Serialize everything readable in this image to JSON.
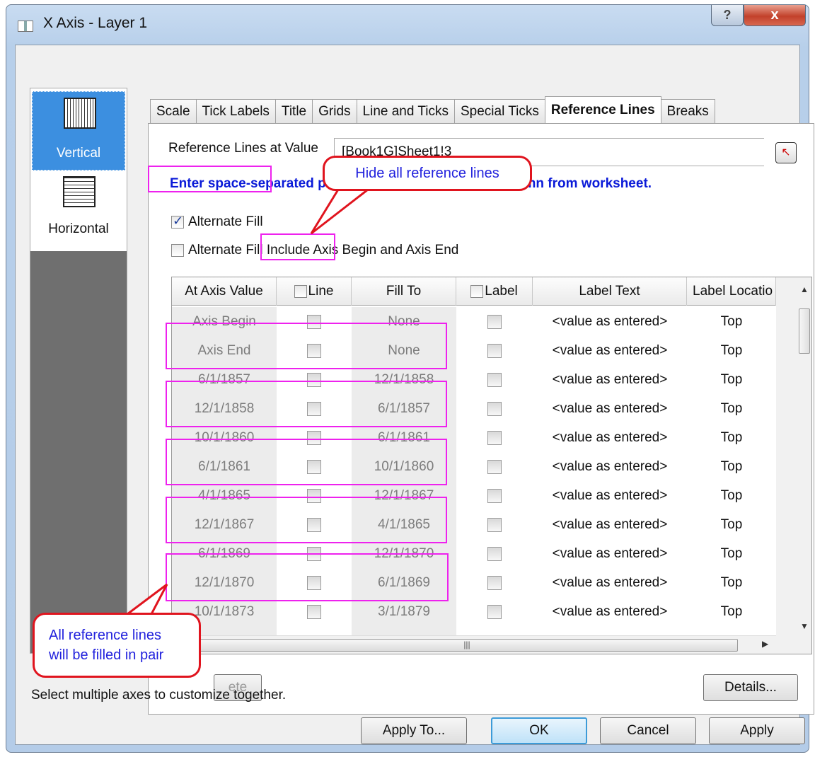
{
  "window": {
    "title": "X Axis - Layer 1",
    "help_glyph": "?",
    "close_glyph": "x"
  },
  "axis_list": {
    "items": [
      {
        "label": "Vertical",
        "selected": true,
        "icon": "vertical-axis-icon"
      },
      {
        "label": "Horizontal",
        "selected": false,
        "icon": "horizontal-axis-icon"
      }
    ]
  },
  "tabs": [
    "Scale",
    "Tick Labels",
    "Title",
    "Grids",
    "Line and Ticks",
    "Special Ticks",
    "Reference Lines",
    "Breaks"
  ],
  "active_tab": "Reference Lines",
  "reference_lines": {
    "value_label": "Reference Lines at Value",
    "value_input": "[Book1G]Sheet1!3",
    "hint": "Enter space-separated position values OR select a column from worksheet.",
    "alternate_fill_label": "Alternate Fill",
    "alternate_fill_checked": true,
    "alternate_fill_include_label": "Alternate Fill Include Axis Begin and Axis End",
    "alternate_fill_include_checked": false
  },
  "table": {
    "headers": [
      "At Axis Value",
      "Line",
      "Fill To",
      "Label",
      "Label Text",
      "Label Locatio"
    ],
    "rows": [
      {
        "at": "Axis Begin",
        "fill_to": "None",
        "label_text": "<value as entered>",
        "location": "Top"
      },
      {
        "at": "Axis End",
        "fill_to": "None",
        "label_text": "<value as entered>",
        "location": "Top"
      },
      {
        "at": "6/1/1857",
        "fill_to": "12/1/1858",
        "label_text": "<value as entered>",
        "location": "Top"
      },
      {
        "at": "12/1/1858",
        "fill_to": "6/1/1857",
        "label_text": "<value as entered>",
        "location": "Top"
      },
      {
        "at": "10/1/1860",
        "fill_to": "6/1/1861",
        "label_text": "<value as entered>",
        "location": "Top"
      },
      {
        "at": "6/1/1861",
        "fill_to": "10/1/1860",
        "label_text": "<value as entered>",
        "location": "Top"
      },
      {
        "at": "4/1/1865",
        "fill_to": "12/1/1867",
        "label_text": "<value as entered>",
        "location": "Top"
      },
      {
        "at": "12/1/1867",
        "fill_to": "4/1/1865",
        "label_text": "<value as entered>",
        "location": "Top"
      },
      {
        "at": "6/1/1869",
        "fill_to": "12/1/1870",
        "label_text": "<value as entered>",
        "location": "Top"
      },
      {
        "at": "12/1/1870",
        "fill_to": "6/1/1869",
        "label_text": "<value as entered>",
        "location": "Top"
      },
      {
        "at": "10/1/1873",
        "fill_to": "3/1/1879",
        "label_text": "<value as entered>",
        "location": "Top"
      }
    ]
  },
  "buttons": {
    "delete": "ete",
    "details": "Details...",
    "apply_to": "Apply To...",
    "ok": "OK",
    "cancel": "Cancel",
    "apply": "Apply"
  },
  "status": "Select multiple axes to customize together.",
  "annotations": {
    "hide_lines": "Hide all reference lines",
    "fill_pair_line1": "All reference lines",
    "fill_pair_line2": "will be filled in pair"
  },
  "colors": {
    "annotation_box": "#ee22ee",
    "callout_border": "#e0141e",
    "callout_text": "#2222dd",
    "hint_text": "#0a1ad8",
    "selected_item": "#3c8fe0"
  }
}
